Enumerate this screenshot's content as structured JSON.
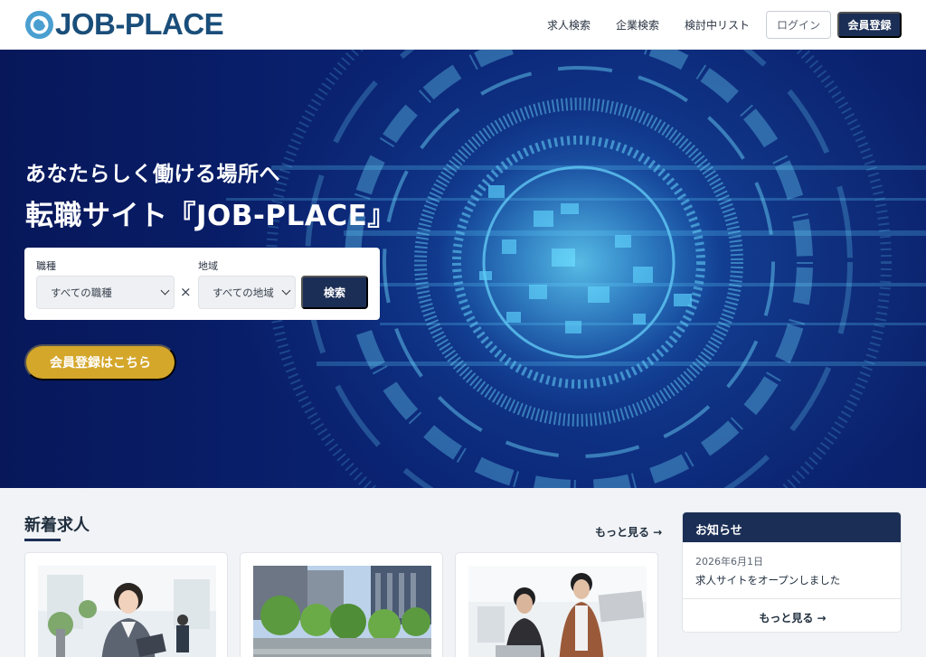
{
  "header": {
    "logo_text": "JOB-PLACE",
    "nav": [
      "求人検索",
      "企業検索",
      "検討中リスト"
    ],
    "login_label": "ログイン",
    "register_label": "会員登録"
  },
  "hero": {
    "subtitle": "あなたらしく働ける場所へ",
    "title": "転職サイト『JOB-PLACE』",
    "search": {
      "job_type_label": "職種",
      "job_type_value": "すべての職種",
      "times": "×",
      "region_label": "地域",
      "region_value": "すべての地域",
      "search_button": "検索"
    },
    "cta_label": "会員登録はこちら"
  },
  "new_jobs": {
    "title": "新着求人",
    "more_label": "もっと見る →"
  },
  "news": {
    "title": "お知らせ",
    "items": [
      {
        "date": "2026年6月1日",
        "text": "求人サイトをオープンしました"
      }
    ],
    "more_label": "もっと見る →"
  },
  "colors": {
    "navy": "#1b2e55",
    "logo_blue": "#1a4e7a",
    "accent_gold": "#d4a62a",
    "hero_bg": "#0a2373"
  },
  "icons": [
    "logo-mark-icon",
    "chevron-down-icon",
    "arrow-right-icon"
  ]
}
